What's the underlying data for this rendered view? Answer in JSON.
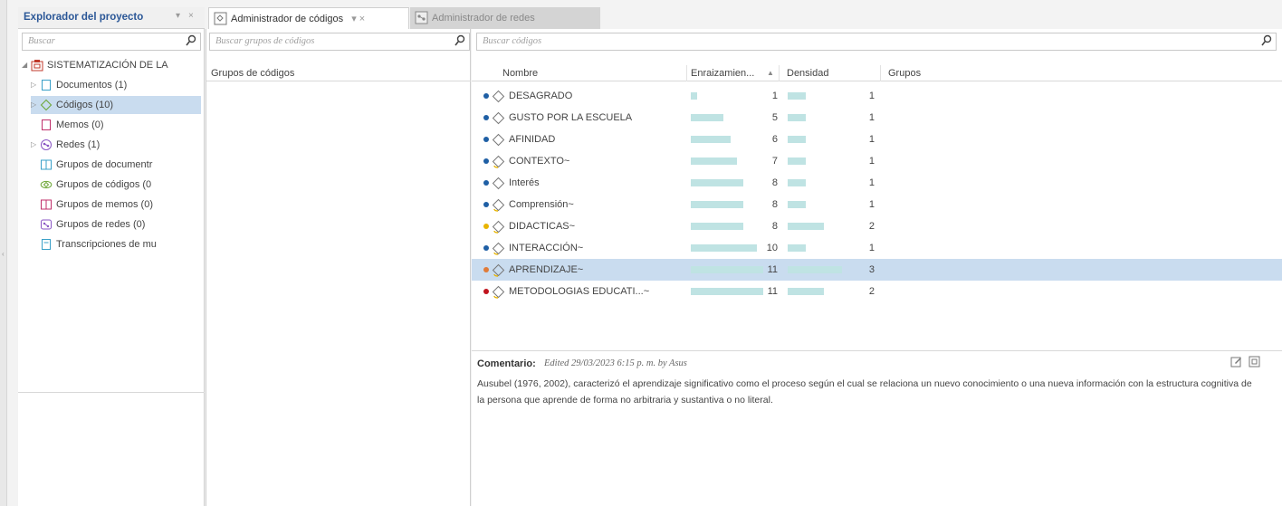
{
  "explorer": {
    "title": "Explorador del proyecto",
    "pin_glyph": "▾",
    "close_glyph": "×",
    "search_placeholder": "Buscar",
    "tree": [
      {
        "label": "SISTEMATIZACIÓN DE LA",
        "icon": "project-icon",
        "toggle": "◢",
        "indent": 0
      },
      {
        "label": "Documentos (1)",
        "icon": "document-icon",
        "toggle": "▷",
        "indent": 1
      },
      {
        "label": "Códigos (10)",
        "icon": "code-diamond-icon",
        "toggle": "▷",
        "indent": 1,
        "selected": true
      },
      {
        "label": "Memos (0)",
        "icon": "memo-icon",
        "toggle": "",
        "indent": 1
      },
      {
        "label": "Redes (1)",
        "icon": "network-icon",
        "toggle": "▷",
        "indent": 1
      },
      {
        "label": "Grupos de documentr",
        "icon": "document-group-icon",
        "toggle": "",
        "indent": 1
      },
      {
        "label": "Grupos de códigos (0",
        "icon": "code-group-icon",
        "toggle": "",
        "indent": 1
      },
      {
        "label": "Grupos de memos (0)",
        "icon": "memo-group-icon",
        "toggle": "",
        "indent": 1
      },
      {
        "label": "Grupos de redes (0)",
        "icon": "network-group-icon",
        "toggle": "",
        "indent": 1
      },
      {
        "label": "Transcripciones de mu",
        "icon": "transcription-icon",
        "toggle": "",
        "indent": 1
      }
    ]
  },
  "tabs": [
    {
      "label": "Administrador de códigos",
      "controls": "▾ ×",
      "active": true
    },
    {
      "label": "Administrador de redes",
      "active": false
    }
  ],
  "groups_pane": {
    "search_placeholder": "Buscar grupos de códigos",
    "column_header": "Grupos de códigos"
  },
  "codes_pane": {
    "search_placeholder": "Buscar códigos",
    "columns": {
      "name": "Nombre",
      "grounded": "Enraizamien...",
      "sort_glyph": "▲",
      "density": "Densidad",
      "groups": "Grupos"
    },
    "max_grounded": 11,
    "max_density": 3,
    "rows": [
      {
        "name": "DESAGRADO",
        "grounded": 1,
        "density": 1,
        "color": "#1f5fa5",
        "has_comment": false
      },
      {
        "name": "GUSTO POR LA ESCUELA",
        "grounded": 5,
        "density": 1,
        "color": "#1f5fa5",
        "has_comment": false
      },
      {
        "name": "AFINIDAD",
        "grounded": 6,
        "density": 1,
        "color": "#1f5fa5",
        "has_comment": false
      },
      {
        "name": "CONTEXTO~",
        "grounded": 7,
        "density": 1,
        "color": "#1f5fa5",
        "has_comment": true
      },
      {
        "name": "Interés",
        "grounded": 8,
        "density": 1,
        "color": "#1f5fa5",
        "has_comment": false
      },
      {
        "name": "Comprensión~",
        "grounded": 8,
        "density": 1,
        "color": "#1f5fa5",
        "has_comment": true
      },
      {
        "name": "DIDACTICAS~",
        "grounded": 8,
        "density": 2,
        "color": "#e8b400",
        "has_comment": true
      },
      {
        "name": "INTERACCIÓN~",
        "grounded": 10,
        "density": 1,
        "color": "#1f5fa5",
        "has_comment": true
      },
      {
        "name": "APRENDIZAJE~",
        "grounded": 11,
        "density": 3,
        "color": "#e07b39",
        "has_comment": true,
        "selected": true
      },
      {
        "name": "METODOLOGIAS EDUCATI...~",
        "grounded": 11,
        "density": 2,
        "color": "#c0141e",
        "has_comment": true
      }
    ]
  },
  "comment": {
    "label": "Comentario:",
    "meta": "Edited 29/03/2023 6:15 p. m. by Asus",
    "text": "Ausubel (1976, 2002), caracterizó el aprendizaje significativo como el proceso según el cual se relaciona un nuevo conocimiento o una nueva información con la estructura cognitiva de la persona que aprende de forma no arbitraria y sustantiva o no literal."
  }
}
